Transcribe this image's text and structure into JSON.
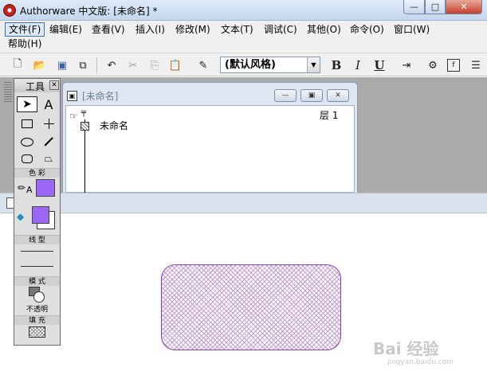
{
  "window": {
    "title": "Authorware 中文版: [未命名] *",
    "min_glyph": "—",
    "max_glyph": "□",
    "close_glyph": "✕"
  },
  "menu": {
    "row1": [
      "文件(F)",
      "编辑(E)",
      "查看(V)",
      "插入(I)",
      "修改(M)",
      "文本(T)",
      "调试(C)",
      "其他(O)",
      "命令(O)",
      "窗口(W)"
    ],
    "row2": [
      "帮助(H)"
    ]
  },
  "toolbar": {
    "style_combo_value": "(默认风格)",
    "bold_label": "B",
    "italic_label": "I",
    "underline_label": "U",
    "icons": [
      "new-file-icon",
      "open-icon",
      "save-all-icon",
      "import-icon",
      "undo-icon",
      "cut-icon",
      "copy-icon",
      "paste-icon",
      "find-icon",
      "run-icon",
      "control-panel-icon",
      "functions-icon",
      "variables-icon"
    ]
  },
  "flowline_window": {
    "title": "[未命名]",
    "level_label": "层 1",
    "node_label": "未命名"
  },
  "tools_palette": {
    "title": "工具",
    "close_glyph": "✕",
    "color_section": "色 彩",
    "line_section": "线 型",
    "mode_section": "模 式",
    "mode_value": "不透明",
    "fill_section": "填 充"
  },
  "presentation": {
    "shape_fill_color": "#c39bd2",
    "shape_border_color": "#8d3fa8"
  },
  "watermark": {
    "main": "Bai 经验",
    "sub": "jingyan.baidu.com"
  },
  "colors": {
    "line_color": "#9b67f5",
    "fill_foreground": "#9b67f5",
    "fill_background": "#ffffff"
  }
}
